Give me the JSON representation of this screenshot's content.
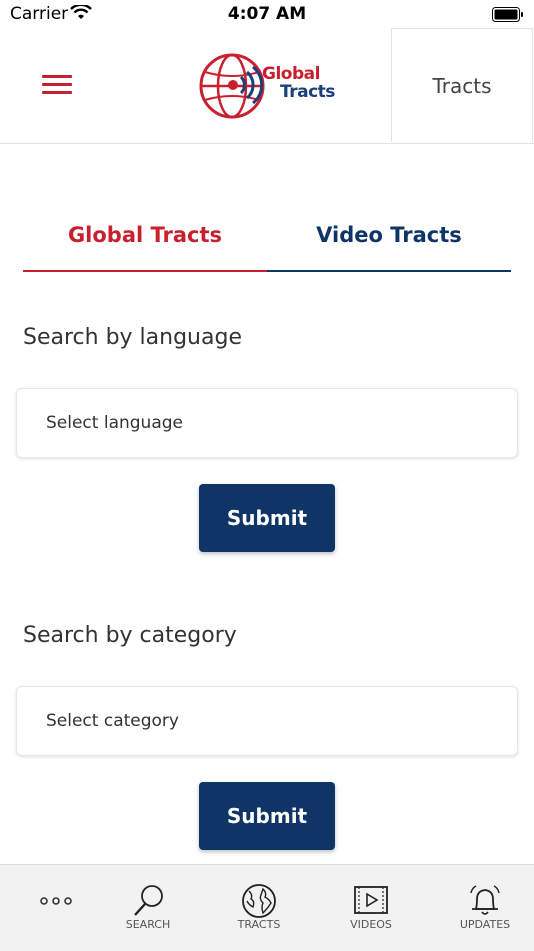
{
  "status_bar": {
    "carrier": "Carrier",
    "time": "4:07 AM"
  },
  "header": {
    "logo_line1": "Global",
    "logo_line2": "Tracts",
    "tracts_button": "Tracts"
  },
  "tabs": [
    {
      "label": "Global Tracts",
      "active": true,
      "color": "#c8202f"
    },
    {
      "label": "Video Tracts",
      "active": false,
      "color": "#0f3466"
    }
  ],
  "language_section": {
    "label": "Search by language",
    "select_placeholder": "Select language",
    "submit_label": "Submit"
  },
  "category_section": {
    "label": "Search by category",
    "select_placeholder": "Select category",
    "submit_label": "Submit"
  },
  "bottom_tabs": [
    {
      "label": "",
      "icon": "more-dots-icon"
    },
    {
      "label": "SEARCH",
      "icon": "search-icon"
    },
    {
      "label": "TRACTS",
      "icon": "globe-icon"
    },
    {
      "label": "VIDEOS",
      "icon": "video-icon"
    },
    {
      "label": "UPDATES",
      "icon": "bell-icon"
    }
  ],
  "colors": {
    "brand_red": "#c8202f",
    "brand_navy": "#0f3466"
  }
}
